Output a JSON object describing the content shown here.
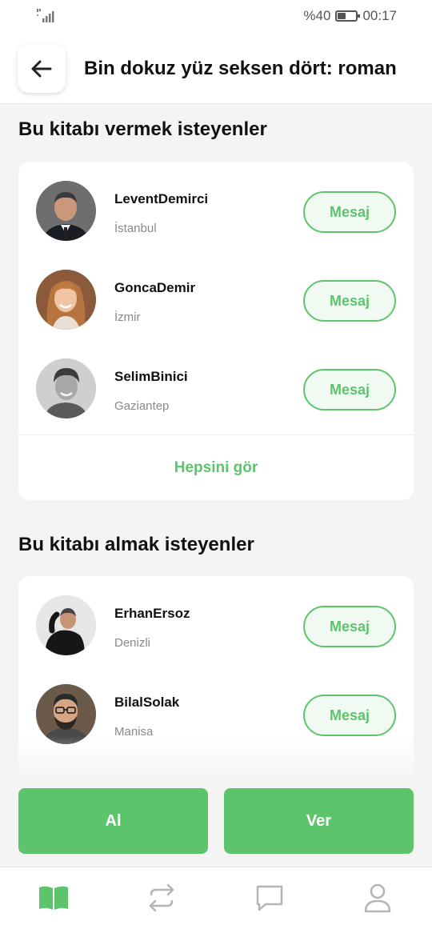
{
  "status_bar": {
    "battery": "%40",
    "time": "00:17"
  },
  "header": {
    "title": "Bin dokuz yüz seksen dört: roman"
  },
  "give_section": {
    "title": "Bu kitabı vermek isteyenler",
    "users": [
      {
        "name": "LeventDemirci",
        "city": "İstanbul",
        "button": "Mesaj"
      },
      {
        "name": "GoncaDemir",
        "city": "İzmir",
        "button": "Mesaj"
      },
      {
        "name": "SelimBinici",
        "city": "Gaziantep",
        "button": "Mesaj"
      }
    ],
    "see_all": "Hepsini gör"
  },
  "take_section": {
    "title": "Bu kitabı almak isteyenler",
    "users": [
      {
        "name": "ErhanErsoz",
        "city": "Denizli",
        "button": "Mesaj"
      },
      {
        "name": "BilalSolak",
        "city": "Manisa",
        "button": "Mesaj"
      }
    ]
  },
  "actions": {
    "take": "Al",
    "give": "Ver"
  },
  "tabs": [
    {
      "icon": "book-icon",
      "active": true
    },
    {
      "icon": "exchange-icon",
      "active": false
    },
    {
      "icon": "chat-icon",
      "active": false
    },
    {
      "icon": "profile-icon",
      "active": false
    }
  ],
  "colors": {
    "accent": "#5ec46c",
    "background": "#f4f4f4",
    "inactive_icon": "#b5b5b5"
  }
}
